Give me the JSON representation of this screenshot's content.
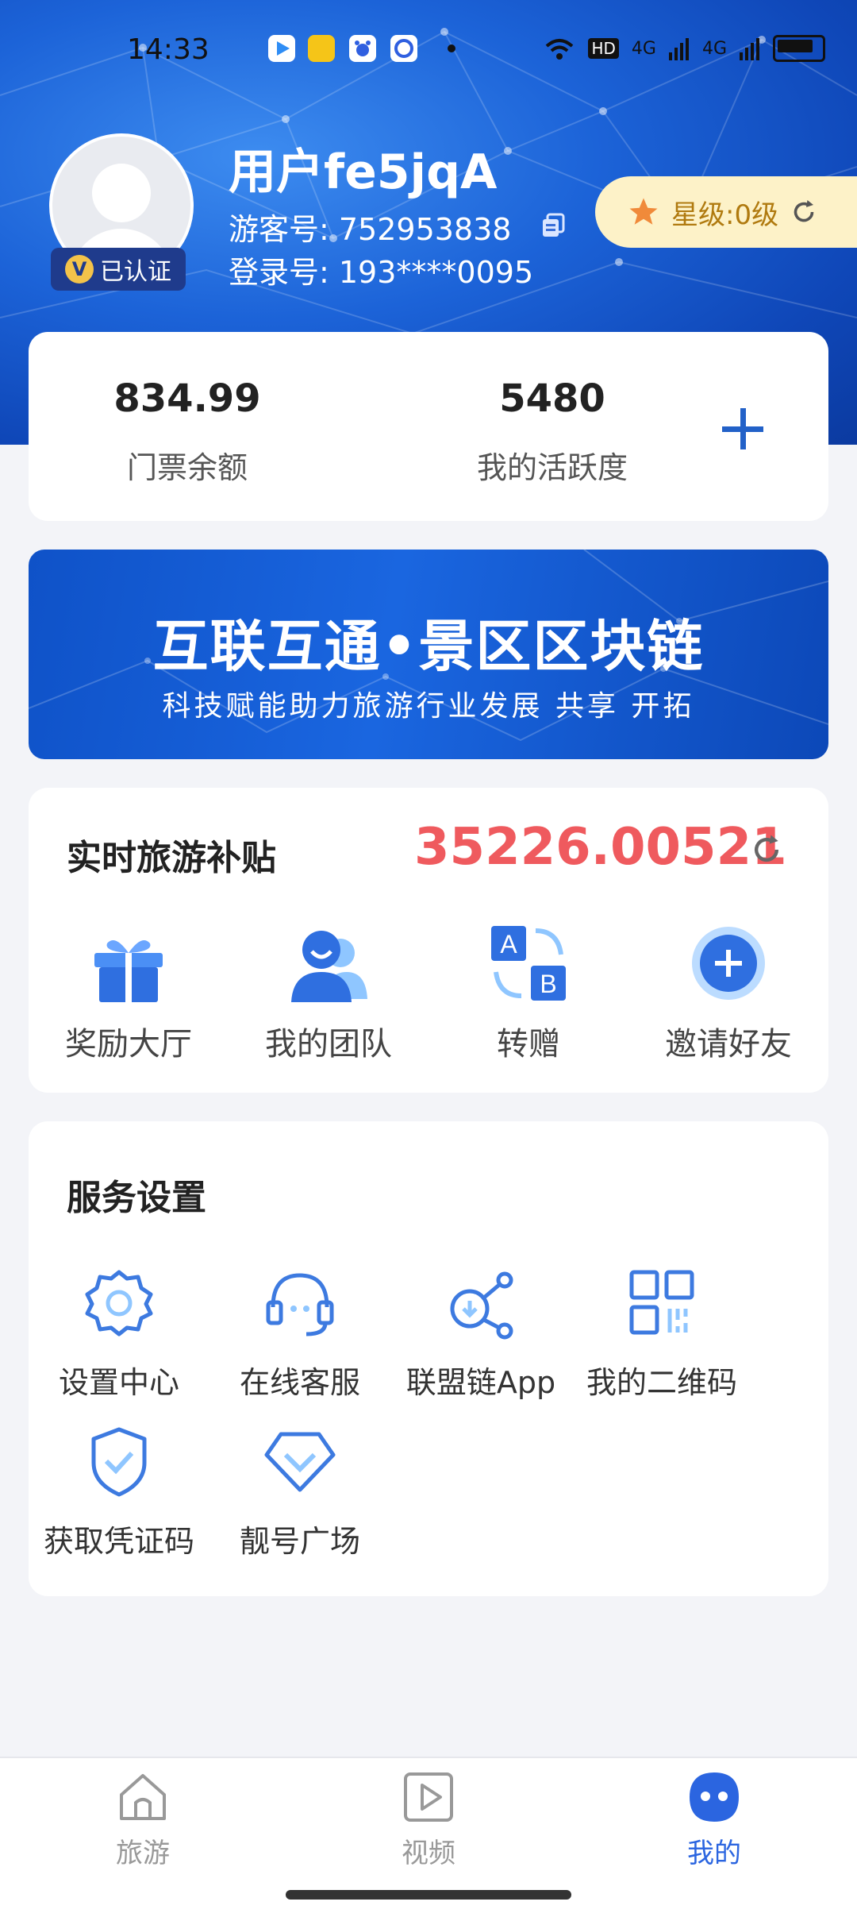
{
  "status_bar": {
    "time": "14:33",
    "network_badge": "HD",
    "signal_1": "4G",
    "signal_2": "4G"
  },
  "profile": {
    "username": "用户fe5jqA",
    "visitor_id_label": "游客号: 752953838",
    "login_label": "登录号: 193****0095",
    "verified_label": "已认证",
    "verified_badge_letter": "V",
    "star_level_label": "星级:0级"
  },
  "stats": {
    "ticket_balance_value": "834.99",
    "ticket_balance_label": "门票余额",
    "activity_value": "5480",
    "activity_label": "我的活跃度"
  },
  "banner": {
    "title": "互联互通•景区区块链",
    "subtitle": "科技赋能助力旅游行业发展 共享 开拓"
  },
  "subsidy": {
    "title": "实时旅游补贴",
    "value": "35226.00521",
    "items": [
      {
        "label": "奖励大厅",
        "icon": "gift-icon"
      },
      {
        "label": "我的团队",
        "icon": "team-icon"
      },
      {
        "label": "转赠",
        "icon": "transfer-icon",
        "icon_letters": [
          "A",
          "B"
        ]
      },
      {
        "label": "邀请好友",
        "icon": "invite-icon"
      }
    ]
  },
  "services": {
    "title": "服务设置",
    "items": [
      {
        "label": "设置中心",
        "icon": "gear-icon"
      },
      {
        "label": "在线客服",
        "icon": "headset-icon"
      },
      {
        "label": "联盟链App",
        "icon": "share-icon"
      },
      {
        "label": "我的二维码",
        "icon": "qrcode-icon"
      },
      {
        "label": "获取凭证码",
        "icon": "shield-check-icon"
      },
      {
        "label": "靓号广场",
        "icon": "diamond-icon"
      }
    ]
  },
  "tabbar": {
    "tabs": [
      {
        "label": "旅游",
        "icon": "home-icon",
        "active": false
      },
      {
        "label": "视频",
        "icon": "video-icon",
        "active": false
      },
      {
        "label": "我的",
        "icon": "profile-face-icon",
        "active": true
      }
    ]
  },
  "colors": {
    "accent": "#2b65e0",
    "subsidy_value": "#ef5a5e",
    "hero_blue": "#1c63d8",
    "star_pill": "#fdf2c8"
  }
}
